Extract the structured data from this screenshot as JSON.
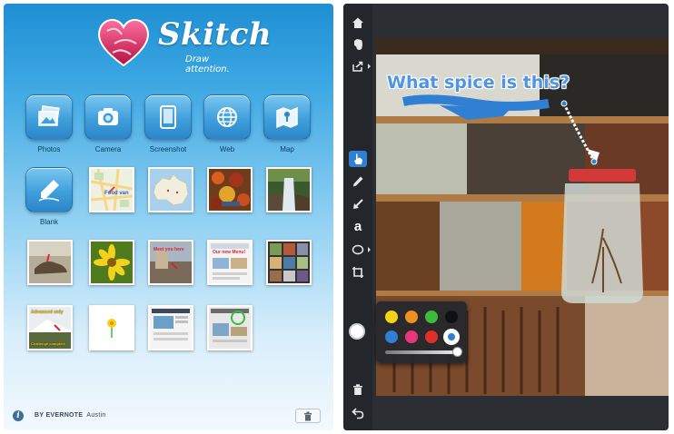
{
  "left_app": {
    "logo": {
      "name": "Skitch",
      "tagline": "Draw attention."
    },
    "capture_buttons": [
      {
        "label": "Photos",
        "icon": "photos-icon"
      },
      {
        "label": "Camera",
        "icon": "camera-icon"
      },
      {
        "label": "Screenshot",
        "icon": "screenshot-icon"
      },
      {
        "label": "Web",
        "icon": "globe-icon"
      },
      {
        "label": "Map",
        "icon": "map-icon"
      },
      {
        "label": "Blank",
        "icon": "pen-icon"
      }
    ],
    "thumbnail_texts": {
      "food_van": "Food van",
      "meet_here": "Meet you here",
      "new_menu": "Our new Menu!",
      "advanced_only": "Advanced only",
      "challenge": "Challenge complete"
    },
    "footer": {
      "info": "i",
      "brand": "BY EVERNOTE",
      "user": "Austin"
    }
  },
  "right_app": {
    "annotation": "What spice is this?",
    "tools": [
      {
        "name": "home-icon"
      },
      {
        "name": "evernote-icon"
      },
      {
        "name": "share-icon"
      },
      {
        "name": "select-hand-icon"
      },
      {
        "name": "pen-tool-icon"
      },
      {
        "name": "arrow-tool-icon"
      },
      {
        "name": "text-tool-icon",
        "label": "a"
      },
      {
        "name": "shape-tool-icon"
      },
      {
        "name": "crop-tool-icon"
      },
      {
        "name": "trash-icon"
      },
      {
        "name": "undo-icon"
      }
    ],
    "palette": {
      "colors": [
        "#f7d21b",
        "#f0901e",
        "#3dbb3a",
        "#111111",
        "#2f7fd2",
        "#e8367a",
        "#df2f2b",
        "#ffffff"
      ],
      "selected_index": 7,
      "stroke_size": 0.9
    },
    "current_color": "#ffffff"
  }
}
